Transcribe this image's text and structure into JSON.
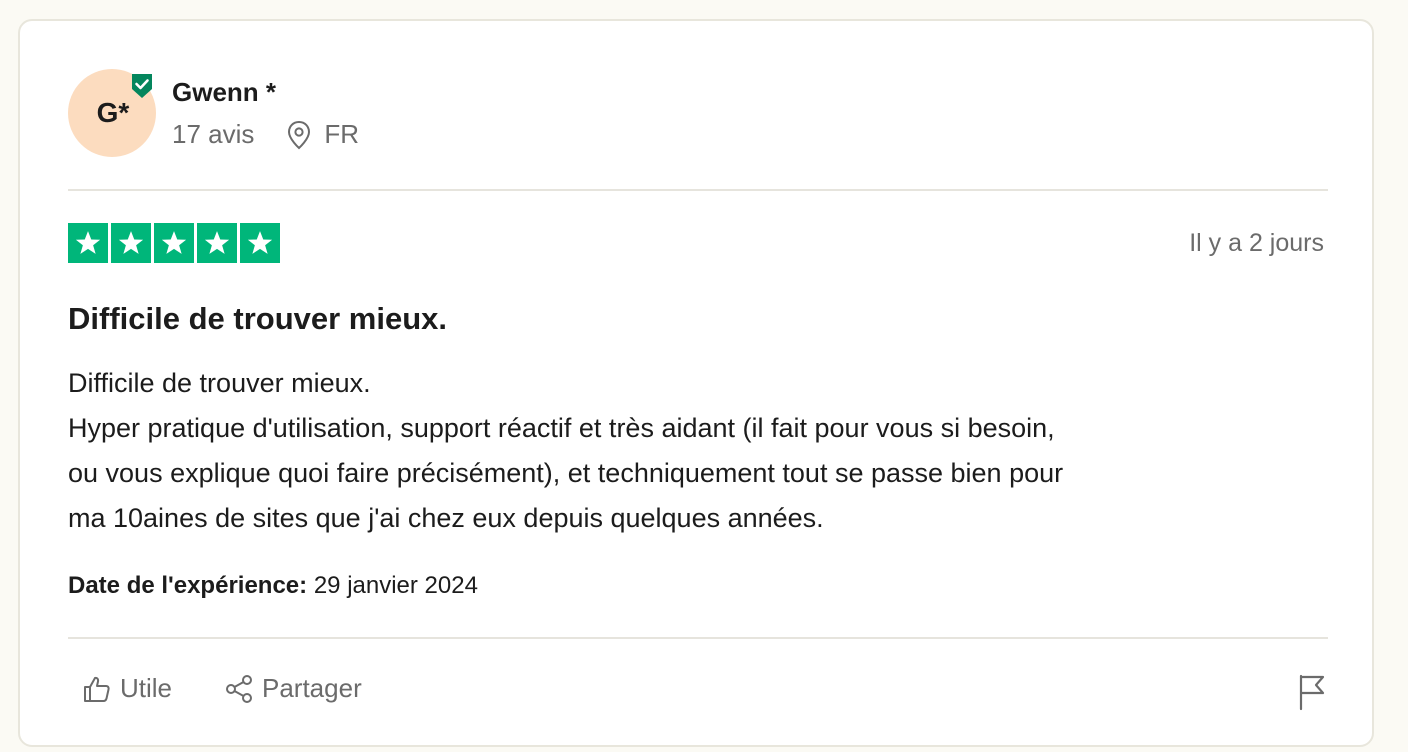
{
  "reviewer": {
    "initials": "G*",
    "name": "Gwenn *",
    "review_count": "17 avis",
    "country": "FR",
    "verified_icon": "shield-check-icon",
    "location_icon": "location-pin-icon"
  },
  "review": {
    "rating": 5,
    "max_rating": 5,
    "posted": "Il y a 2 jours",
    "title": "Difficile de trouver mieux.",
    "body_lines": [
      "Difficile de trouver mieux.",
      "Hyper pratique d'utilisation, support réactif et très aidant (il fait pour vous si besoin,",
      "ou vous explique quoi faire précisément), et techniquement tout se passe bien pour",
      "ma 10aines de sites que j'ai chez eux depuis quelques années."
    ],
    "experience_label": "Date de l'expérience:",
    "experience_date": "29 janvier 2024"
  },
  "actions": {
    "useful_label": "Utile",
    "share_label": "Partager",
    "useful_icon": "thumbs-up-icon",
    "share_icon": "share-icon",
    "flag_icon": "flag-icon"
  },
  "colors": {
    "star_green": "#00b67a",
    "verified_green": "#04865d",
    "avatar_bg": "#fcdcbf",
    "muted_text": "#6b6b6b"
  }
}
